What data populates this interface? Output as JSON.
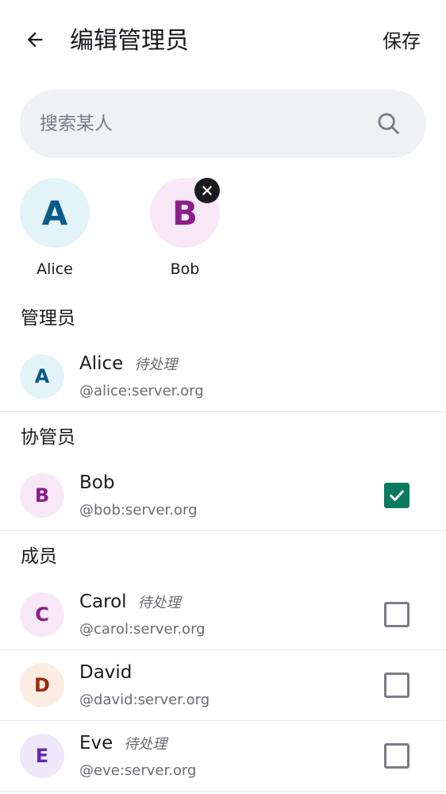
{
  "header": {
    "title": "编辑管理员",
    "save_label": "保存"
  },
  "search": {
    "placeholder": "搜索某人"
  },
  "selected": [
    {
      "initial": "A",
      "name": "Alice",
      "avatar_bg": "#e3f4f9",
      "avatar_fg": "#0a5a8a",
      "removable": false
    },
    {
      "initial": "B",
      "name": "Bob",
      "avatar_bg": "#f8e8f7",
      "avatar_fg": "#8a1e8a",
      "removable": true
    }
  ],
  "sections": {
    "admins": "管理员",
    "moderators": "协管员",
    "members": "成员"
  },
  "users": [
    {
      "initial": "A",
      "name": "Alice",
      "pending": "待处理",
      "handle": "@alice:server.org",
      "avatar_bg": "#e3f4f9",
      "avatar_fg": "#0a5a8a"
    },
    {
      "initial": "B",
      "name": "Bob",
      "pending": "",
      "handle": "@bob:server.org",
      "avatar_bg": "#f8e8f7",
      "avatar_fg": "#8a1e8a",
      "checked": true
    },
    {
      "initial": "C",
      "name": "Carol",
      "pending": "待处理",
      "handle": "@carol:server.org",
      "avatar_bg": "#f8e8f7",
      "avatar_fg": "#8a1e8a",
      "checked": false
    },
    {
      "initial": "D",
      "name": "David",
      "pending": "",
      "handle": "@david:server.org",
      "avatar_bg": "#fdece2",
      "avatar_fg": "#9e2a0a",
      "checked": false
    },
    {
      "initial": "E",
      "name": "Eve",
      "pending": "待处理",
      "handle": "@eve:server.org",
      "avatar_bg": "#efe8fb",
      "avatar_fg": "#5e2ab0",
      "checked": false
    }
  ],
  "colors": {
    "accent_check": "#0b7a5f",
    "search_bg": "#f0f1f5"
  },
  "icons": {
    "back": "arrow-left-icon",
    "search": "search-icon",
    "remove": "close-icon",
    "check": "check-icon"
  }
}
